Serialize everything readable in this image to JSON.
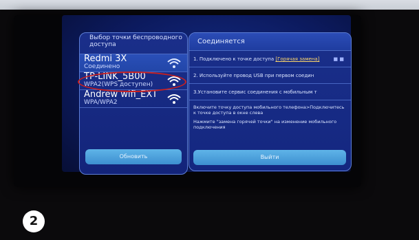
{
  "top_strip_text": "",
  "left_panel": {
    "title": "Выбор точки беспроводного доступа",
    "networks": [
      {
        "name": "Redmi 3X",
        "status": "Соединено",
        "icon": "wifi-icon"
      },
      {
        "name": "TP-LINK_5B00",
        "status": "WPA2(WPS доступен)",
        "icon": "wifi-icon"
      },
      {
        "name": "Andrew wifi_EXT",
        "status": "WPA/WPA2",
        "icon": "wifi-icon"
      }
    ],
    "refresh_label": "Обновить"
  },
  "right_panel": {
    "title": "Соединяется",
    "steps": [
      {
        "text": "1. Подключено к точке доступа ",
        "link": "[Горячая замена]",
        "dots": "■  ■"
      },
      {
        "text": "2. Используйте провод USB при первом соедин"
      },
      {
        "text": "3.Установите сервис соединения с мобильным т"
      }
    ],
    "info_1": "Включите точку доступа мобильного телефона>Подключитесь к точке доступа в окне слева",
    "info_2": "Нажмите \"замена горячей точки\" на изменение мобильного подключения",
    "exit_label": "Выйти"
  },
  "badge": "2",
  "colors": {
    "highlight": "#c82020",
    "button": "#4aa0dc",
    "panel": "#1a2f8a"
  }
}
